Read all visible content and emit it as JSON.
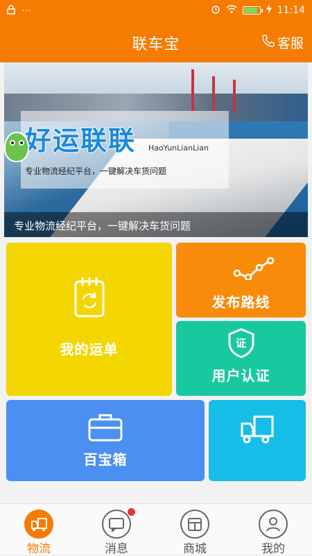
{
  "status_bar": {
    "time": "11:14",
    "notification_dots": "···"
  },
  "header": {
    "title": "联车宝",
    "service_label": "客服"
  },
  "banner": {
    "promo_title": "好运联联",
    "promo_pinyin": "HaoYunLianLian",
    "promo_subtitle": "专业物流经纪平台，一键解决车货问题",
    "caption": "专业物流经纪平台，一键解决车货问题"
  },
  "tiles": {
    "waybill": "我的运单",
    "publish_route": "发布路线",
    "user_verify": "用户认证",
    "verify_badge": "证",
    "toolbox": "百宝箱"
  },
  "tabs": [
    {
      "label": "物流",
      "icon": "logistics-truck-icon",
      "active": true
    },
    {
      "label": "消息",
      "icon": "message-icon",
      "badge": true
    },
    {
      "label": "商城",
      "icon": "store-icon"
    },
    {
      "label": "我的",
      "icon": "profile-icon"
    }
  ],
  "colors": {
    "brand": "#f57c00",
    "tile_yellow": "#f3d500",
    "tile_orange": "#f98b0a",
    "tile_green": "#18c9a0",
    "tile_blue": "#4b8ff0",
    "tile_cyan": "#16bde6"
  }
}
